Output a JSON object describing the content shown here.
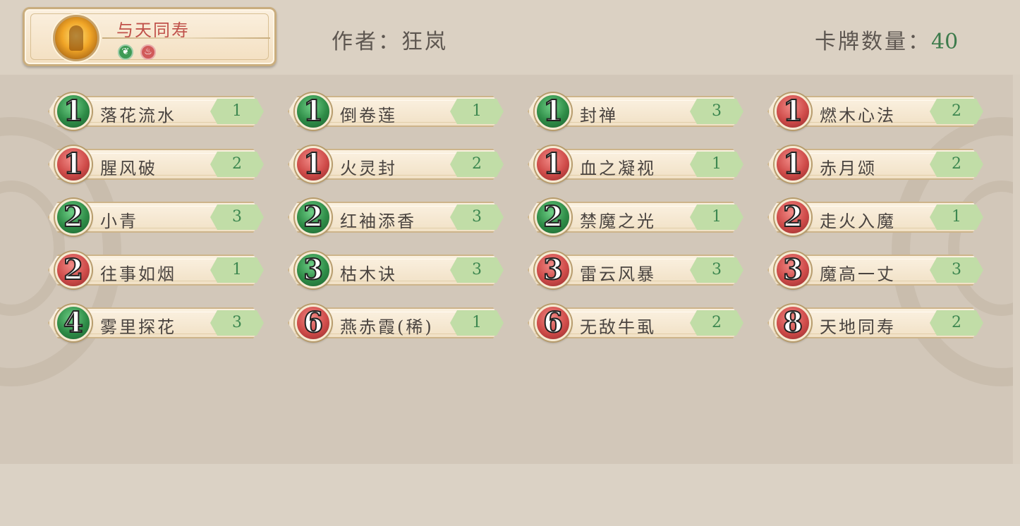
{
  "deck": {
    "name": "与天同寿",
    "elements": [
      {
        "name": "wood-element",
        "glyph": "❦"
      },
      {
        "name": "fire-element",
        "glyph": "♨"
      }
    ]
  },
  "header": {
    "author_label": "作者：狂岚",
    "count_label": "卡牌数量：",
    "count_value": "40"
  },
  "cards": [
    {
      "cost": "1",
      "color": "green",
      "name": "落花流水",
      "qty": "1"
    },
    {
      "cost": "1",
      "color": "green",
      "name": "倒卷莲",
      "qty": "1"
    },
    {
      "cost": "1",
      "color": "green",
      "name": "封禅",
      "qty": "3"
    },
    {
      "cost": "1",
      "color": "red",
      "name": "燃木心法",
      "qty": "2"
    },
    {
      "cost": "1",
      "color": "red",
      "name": "腥风破",
      "qty": "2"
    },
    {
      "cost": "1",
      "color": "red",
      "name": "火灵封",
      "qty": "2"
    },
    {
      "cost": "1",
      "color": "red",
      "name": "血之凝视",
      "qty": "1"
    },
    {
      "cost": "1",
      "color": "red",
      "name": "赤月颂",
      "qty": "2"
    },
    {
      "cost": "2",
      "color": "green",
      "name": "小青",
      "qty": "3"
    },
    {
      "cost": "2",
      "color": "green",
      "name": "红袖添香",
      "qty": "3"
    },
    {
      "cost": "2",
      "color": "green",
      "name": "禁魔之光",
      "qty": "1"
    },
    {
      "cost": "2",
      "color": "red",
      "name": "走火入魔",
      "qty": "1"
    },
    {
      "cost": "2",
      "color": "red",
      "name": "往事如烟",
      "qty": "1"
    },
    {
      "cost": "3",
      "color": "green",
      "name": "枯木诀",
      "qty": "3"
    },
    {
      "cost": "3",
      "color": "red",
      "name": "雷云风暴",
      "qty": "3"
    },
    {
      "cost": "3",
      "color": "red",
      "name": "魔高一丈",
      "qty": "3"
    },
    {
      "cost": "4",
      "color": "green",
      "name": "雾里探花",
      "qty": "3"
    },
    {
      "cost": "6",
      "color": "red",
      "name": "燕赤霞(稀)",
      "qty": "1"
    },
    {
      "cost": "6",
      "color": "red",
      "name": "无敌牛虱",
      "qty": "2"
    },
    {
      "cost": "8",
      "color": "red",
      "name": "天地同寿",
      "qty": "2"
    }
  ]
}
